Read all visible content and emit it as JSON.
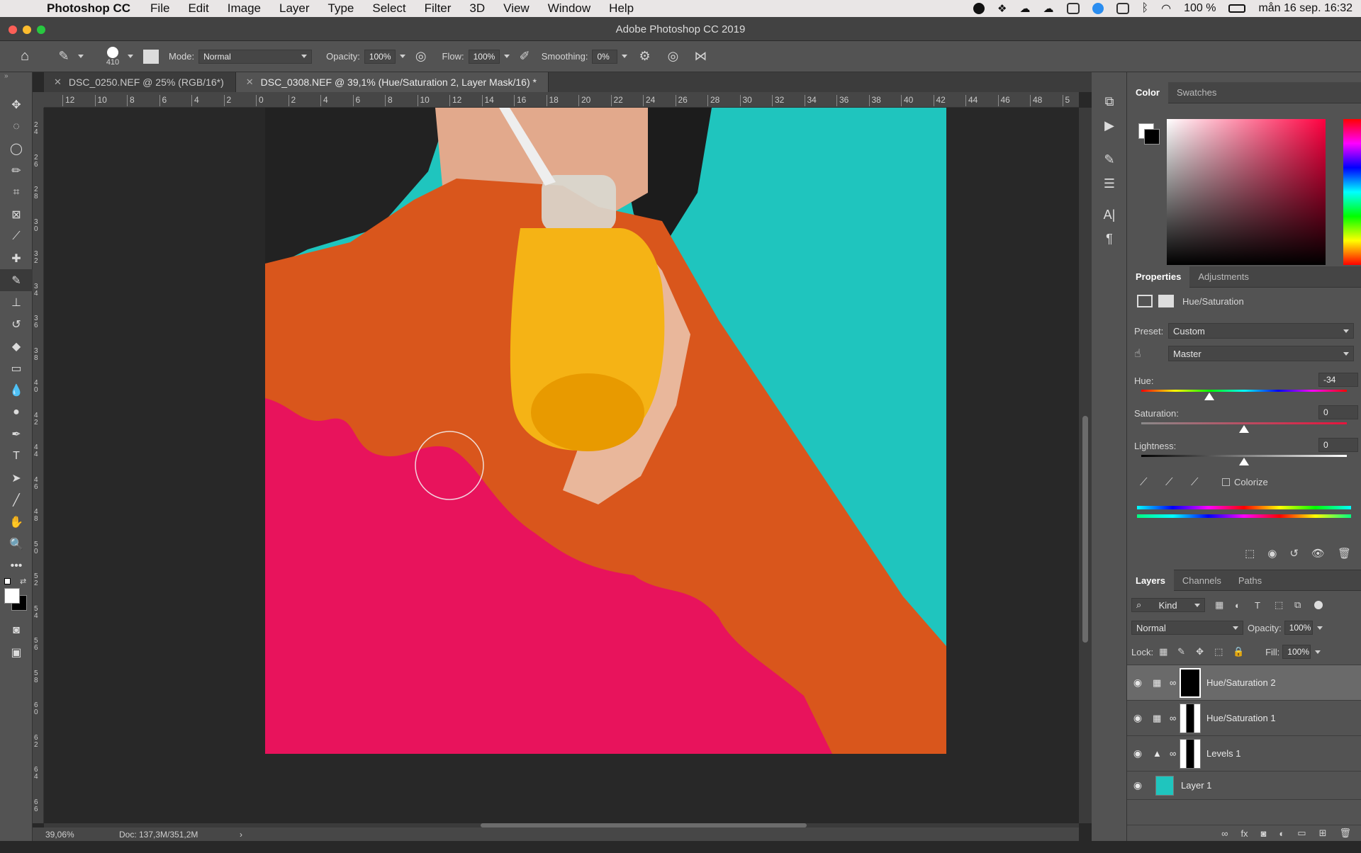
{
  "menubar": {
    "app_name": "Photoshop CC",
    "items": [
      "File",
      "Edit",
      "Image",
      "Layer",
      "Type",
      "Select",
      "Filter",
      "3D",
      "View",
      "Window",
      "Help"
    ],
    "battery": "100 %",
    "datetime": "mån 16 sep.  16:32"
  },
  "window": {
    "title": "Adobe Photoshop CC 2019"
  },
  "options": {
    "brush_size": "410",
    "mode_label": "Mode:",
    "mode_value": "Normal",
    "opacity_label": "Opacity:",
    "opacity_value": "100%",
    "flow_label": "Flow:",
    "flow_value": "100%",
    "smoothing_label": "Smoothing:",
    "smoothing_value": "0%"
  },
  "tabs": [
    {
      "label": "DSC_0250.NEF @ 25% (RGB/16*)"
    },
    {
      "label": "DSC_0308.NEF @ 39,1% (Hue/Saturation 2, Layer Mask/16) *"
    }
  ],
  "ruler": {
    "ticks": [
      "12",
      "10",
      "8",
      "6",
      "4",
      "2",
      "0",
      "2",
      "4",
      "6",
      "8",
      "10",
      "12",
      "14",
      "16",
      "18",
      "20",
      "22",
      "24",
      "26",
      "28",
      "30",
      "32",
      "34",
      "36",
      "38",
      "40",
      "42",
      "44",
      "46",
      "48",
      "5"
    ],
    "vticks": [
      "2 4",
      "2 6",
      "2 8",
      "3 0",
      "3 2",
      "3 4",
      "3 6",
      "3 8",
      "4 0",
      "4 2",
      "4 4",
      "4 6",
      "4 8",
      "5 0",
      "5 2",
      "5 4",
      "5 6",
      "5 8",
      "6 0",
      "6 2",
      "6 4",
      "6 6"
    ]
  },
  "status": {
    "zoom": "39,06%",
    "doc": "Doc: 137,3M/351,2M"
  },
  "color_panel": {
    "tab_color": "Color",
    "tab_swatches": "Swatches"
  },
  "properties": {
    "tab_properties": "Properties",
    "tab_adjustments": "Adjustments",
    "type_label": "Hue/Saturation",
    "preset_label": "Preset:",
    "preset_value": "Custom",
    "channel_value": "Master",
    "hue_label": "Hue:",
    "hue_value": "-34",
    "hue_level": 0.33,
    "saturation_label": "Saturation:",
    "saturation_value": "0",
    "saturation_level": 0.5,
    "lightness_label": "Lightness:",
    "lightness_value": "0",
    "lightness_level": 0.5,
    "colorize_label": "Colorize"
  },
  "layers_panel": {
    "tab_layers": "Layers",
    "tab_channels": "Channels",
    "tab_paths": "Paths",
    "filter_kind": "Kind",
    "blend_mode": "Normal",
    "opacity_label": "Opacity:",
    "opacity_value": "100%",
    "lock_label": "Lock:",
    "fill_label": "Fill:",
    "fill_value": "100%",
    "layers": [
      {
        "name": "Hue/Saturation 2",
        "active": true
      },
      {
        "name": "Hue/Saturation 1",
        "active": false
      },
      {
        "name": "Levels 1",
        "active": false
      },
      {
        "name": "Layer 1",
        "active": false
      }
    ]
  },
  "colors": {
    "bg_turquoise": "#1fc5be",
    "sweater_orange": "#d9561c",
    "sweater_pink": "#e8135c"
  }
}
